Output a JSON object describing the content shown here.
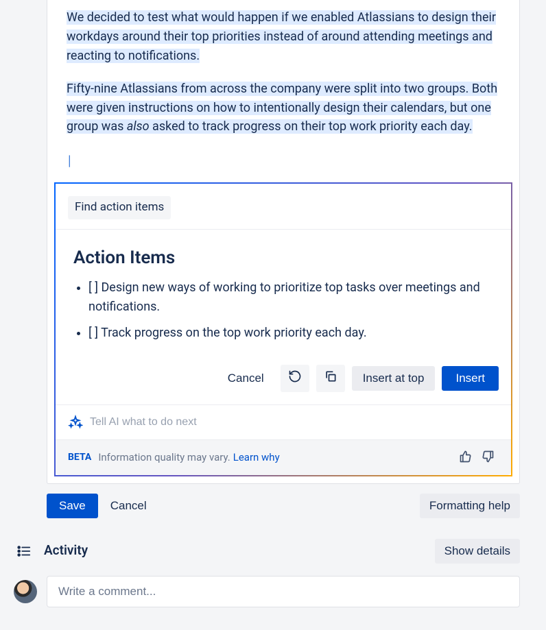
{
  "editor": {
    "paragraph1_html": "We decided to test what would happen if we enabled Atlassians to design their workdays around their top priorities instead of around attending meetings and reacting to notifications.",
    "paragraph2_pre": "Fifty-nine Atlassians from across the company were split into two groups. Both were given instructions on how to intentionally design their calendars, but one group was ",
    "paragraph2_em": "also",
    "paragraph2_post": " asked to track progress on their top work priority each day."
  },
  "ai": {
    "tab_label": "Find action items",
    "heading": "Action Items",
    "items": [
      "[ ] Design new ways of working to prioritize top tasks over meetings and notifications.",
      "[ ] Track progress on the top work priority each day."
    ],
    "actions": {
      "cancel": "Cancel",
      "insert_top": "Insert at top",
      "insert": "Insert"
    },
    "prompt_placeholder": "Tell AI what to do next",
    "footer": {
      "beta": "BETA",
      "info": "Information quality may vary.",
      "learn_why": "Learn why"
    }
  },
  "savebar": {
    "save": "Save",
    "cancel": "Cancel",
    "formatting_help": "Formatting help"
  },
  "activity": {
    "title": "Activity",
    "show_details": "Show details"
  },
  "comment": {
    "placeholder": "Write a comment..."
  }
}
